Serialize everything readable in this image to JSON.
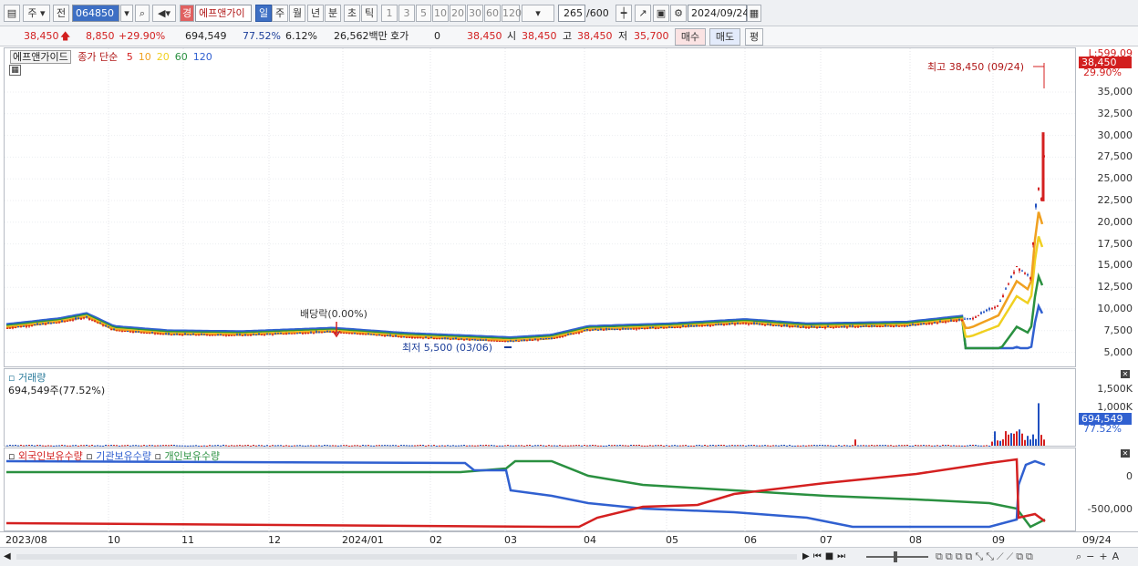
{
  "toolbar": {
    "market": "주",
    "view": "전",
    "code": "064850",
    "name": "에프앤가이",
    "name_tag": "경",
    "periods": [
      "일",
      "주",
      "월",
      "년",
      "분",
      "초",
      "틱"
    ],
    "numbers": [
      "1",
      "3",
      "5",
      "10",
      "20",
      "30",
      "60",
      "120"
    ],
    "count": "265",
    "count_max": "/600",
    "date": "2024/09/24"
  },
  "quote": {
    "price": "38,450",
    "change": "8,850",
    "change_pct": "+29.90%",
    "volume": "694,549",
    "vol_ratio": "77.52%",
    "turnover": "6.12%",
    "amount": "26,562백만",
    "hoga_label": "호가",
    "hoga": "0",
    "hoga_price": "38,450",
    "open_label": "시",
    "open": "38,450",
    "high_label": "고",
    "high": "38,450",
    "low_label": "저",
    "low": "35,700",
    "buy": "매수",
    "sell": "매도",
    "eval": "평"
  },
  "price_pane": {
    "legend_name": "에프앤가이드",
    "legend_ma": "종가 단순",
    "ma_periods": [
      "5",
      "10",
      "20",
      "60",
      "120"
    ],
    "ma_colors": [
      "#d42020",
      "#f0a020",
      "#f0d020",
      "#2a9040",
      "#3060d0"
    ],
    "axis_top": "L:599.09",
    "axis_ticks": [
      "35,000",
      "32,500",
      "30,000",
      "27,500",
      "25,000",
      "22,500",
      "20,000",
      "17,500",
      "15,000",
      "12,500",
      "10,000",
      "7,500",
      "5,000"
    ],
    "last_price": "38,450",
    "last_pct": "29.90%",
    "high_note": "최고 38,450 (09/24)",
    "low_note": "최저 5,500 (03/06)",
    "dividend_note": "배당락(0.00%)"
  },
  "volume_pane": {
    "title": "거래량",
    "value": "694,549주(77.52%)",
    "axis_ticks": [
      "1,500K",
      "1,000K"
    ],
    "last": "694,549",
    "last_pct": "77.52%"
  },
  "holder_pane": {
    "legend": [
      "외국인보유수량",
      "기관보유수량",
      "개인보유수량"
    ],
    "legend_colors": [
      "#d42020",
      "#3060d0",
      "#2a9040"
    ],
    "axis_ticks": [
      "0",
      "-500,000"
    ]
  },
  "xaxis": {
    "labels": [
      "2023/08",
      "10",
      "11",
      "12",
      "2024/01",
      "02",
      "03",
      "04",
      "05",
      "06",
      "07",
      "08",
      "09"
    ],
    "last": "09/24"
  },
  "chart_data": {
    "type": "line",
    "title": "",
    "series": [
      {
        "name": "종가",
        "x": [
          "2023/08",
          "2023/09",
          "2023/10",
          "2023/11",
          "2023/12",
          "2024/01",
          "2024/02",
          "2024/03",
          "2024/04",
          "2024/05",
          "2024/06",
          "2024/07",
          "2024/08",
          "2024/09/01",
          "2024/09/10",
          "2024/09/17",
          "2024/09/24"
        ],
        "values": [
          7200,
          8500,
          6700,
          6200,
          6500,
          6700,
          6300,
          5800,
          7300,
          7500,
          7800,
          7400,
          7600,
          8500,
          13000,
          22000,
          38450
        ]
      }
    ],
    "ylim": [
      3000,
      38450
    ],
    "volume_max_k": 1700
  }
}
